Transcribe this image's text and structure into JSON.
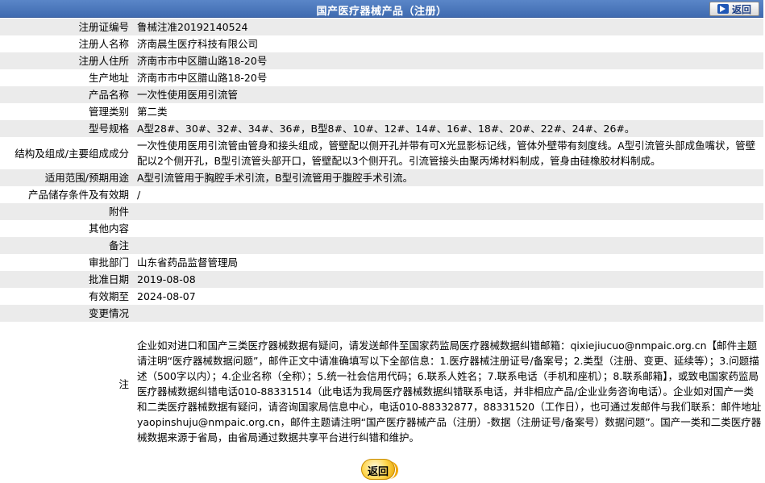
{
  "header": {
    "title": "国产医疗器械产品（注册）",
    "back_label": "返回"
  },
  "rows": [
    {
      "label": "注册证编号",
      "value": "鲁械注准20192140524"
    },
    {
      "label": "注册人名称",
      "value": "济南晨生医疗科技有限公司"
    },
    {
      "label": "注册人住所",
      "value": "济南市市中区腊山路18-20号"
    },
    {
      "label": "生产地址",
      "value": "济南市市中区腊山路18-20号"
    },
    {
      "label": "产品名称",
      "value": "一次性使用医用引流管"
    },
    {
      "label": "管理类别",
      "value": "第二类"
    },
    {
      "label": "型号规格",
      "value": "A型28#、30#、32#、34#、36#，B型8#、10#、12#、14#、16#、18#、20#、22#、24#、26#。"
    },
    {
      "label": "结构及组成/主要组成成分",
      "value": "一次性使用医用引流管由管身和接头组成，管壁配以侧开孔并带有可X光显影标记线，管体外壁带有刻度线。A型引流管头部成鱼嘴状，管壁配以2个侧开孔，B型引流管头部开口，管壁配以3个侧开孔。引流管接头由聚丙烯材料制成，管身由硅橡胶材料制成。"
    },
    {
      "label": "适用范围/预期用途",
      "value": "A型引流管用于胸腔手术引流，B型引流管用于腹腔手术引流。"
    },
    {
      "label": "产品储存条件及有效期",
      "value": "/"
    },
    {
      "label": "附件",
      "value": ""
    },
    {
      "label": "其他内容",
      "value": ""
    },
    {
      "label": "备注",
      "value": ""
    },
    {
      "label": "审批部门",
      "value": "山东省药品监督管理局"
    },
    {
      "label": "批准日期",
      "value": "2019-08-08"
    },
    {
      "label": "有效期至",
      "value": "2024-08-07"
    },
    {
      "label": "变更情况",
      "value": ""
    }
  ],
  "note": {
    "label": "注",
    "text": "企业如对进口和国产三类医疗器械数据有疑问，请发送邮件至国家药监局医疗器械数据纠错邮箱：qixiejiucuo@nmpaic.org.cn【邮件主题请注明“医疗器械数据问题”，邮件正文中请准确填写以下全部信息：1.医疗器械注册证号/备案号；2.类型（注册、变更、延续等）；3.问题描述（500字以内）；4.企业名称（全称）；5.统一社会信用代码；6.联系人姓名；7.联系电话（手机和座机）；8.联系邮箱】，或致电国家药监局医疗器械数据纠错电话010-88331514（此电话为我局医疗器械数据纠错联系电话，并非相应产品/企业业务咨询电话）。企业如对国产一类和二类医疗器械数据有疑问，请咨询国家局信息中心，电话010-88332877，88331520（工作日），也可通过发邮件与我们联系：邮件地址yaopinshuju@nmpaic.org.cn，邮件主题请注明“国产医疗器械产品（注册）-数据（注册证号/备案号）数据问题”。国产一类和二类医疗器械数据来源于省局，由省局通过数据共享平台进行纠错和维护。"
  },
  "footer": {
    "back_label": "返回"
  },
  "colors": {
    "title_bar": "#4a78bf",
    "row_alt": "#ebebeb",
    "back_button_fill": "#ffd54a"
  }
}
